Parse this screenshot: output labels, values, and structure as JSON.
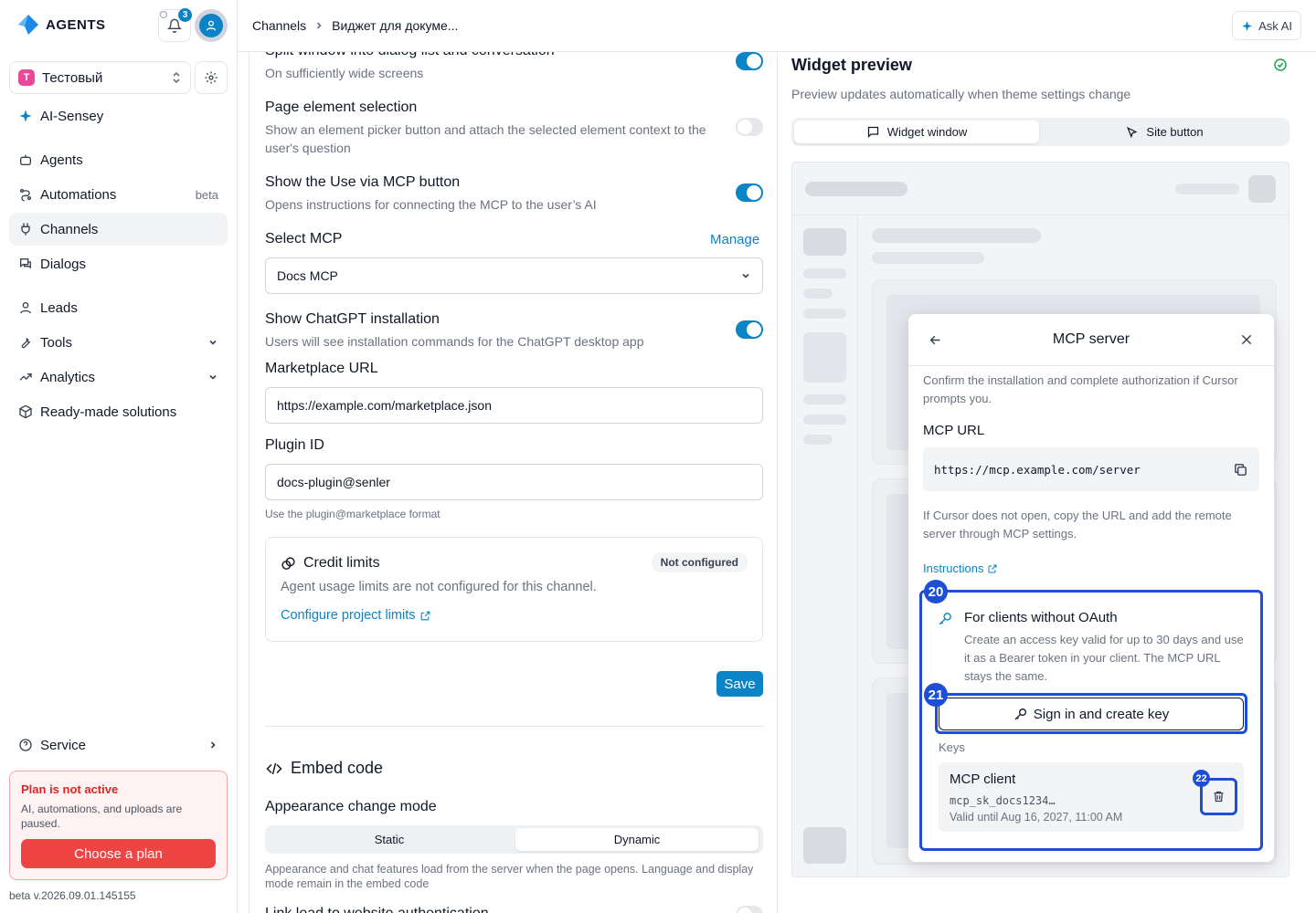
{
  "app": {
    "logo_text": "AGENTS",
    "notification_count": "3"
  },
  "project": {
    "initial": "T",
    "name": "Тестовый"
  },
  "nav": {
    "ai_sensey": "AI-Sensey",
    "agents": "Agents",
    "automations": "Automations",
    "automations_badge": "beta",
    "channels": "Channels",
    "dialogs": "Dialogs",
    "leads": "Leads",
    "tools": "Tools",
    "analytics": "Analytics",
    "ready_made": "Ready-made solutions",
    "service": "Service"
  },
  "plan": {
    "title": "Plan is not active",
    "text": "AI, automations, and uploads are paused.",
    "button": "Choose a plan"
  },
  "version": "beta v.2026.09.01.145155",
  "breadcrumb": {
    "root": "Channels",
    "current": "Виджет для докуме..."
  },
  "ask_ai": "Ask AI",
  "settings": {
    "split_title": "Split window into dialog list and conversation",
    "split_sub": "On sufficiently wide screens",
    "split_on": true,
    "page_sel_title": "Page element selection",
    "page_sel_sub": "Show an element picker button and attach the selected element context to the user's question",
    "page_sel_on": false,
    "mcp_btn_title": "Show the Use via MCP button",
    "mcp_btn_sub": "Opens instructions for connecting the MCP to the user’s AI",
    "mcp_btn_on": true,
    "select_mcp_label": "Select MCP",
    "manage_link": "Manage",
    "select_mcp_value": "Docs MCP",
    "chatgpt_title": "Show ChatGPT installation",
    "chatgpt_sub": "Users will see installation commands for the ChatGPT desktop app",
    "chatgpt_on": true,
    "marketplace_label": "Marketplace URL",
    "marketplace_value": "https://example.com/marketplace.json",
    "plugin_label": "Plugin ID",
    "plugin_value": "docs-plugin@senler",
    "plugin_hint": "Use the plugin@marketplace format",
    "credit_title": "Credit limits",
    "credit_badge": "Not configured",
    "credit_text": "Agent usage limits are not configured for this channel.",
    "credit_link": "Configure project limits",
    "save": "Save",
    "embed_title": "Embed code",
    "appearance_label": "Appearance change mode",
    "appearance_options": [
      "Static",
      "Dynamic"
    ],
    "appearance_selected": "Dynamic",
    "appearance_hint": "Appearance and chat features load from the server when the page opens. Language and display mode remain in the embed code",
    "link_lead_title": "Link lead to website authentication"
  },
  "preview": {
    "title": "Widget preview",
    "subtitle": "Preview updates automatically when theme settings change",
    "tabs": [
      "Widget window",
      "Site button"
    ],
    "selected_tab": "Widget window"
  },
  "dialog": {
    "title": "MCP server",
    "confirm_text": "Confirm the installation and complete authorization if Cursor prompts you.",
    "url_label": "MCP URL",
    "url_value": "https://mcp.example.com/server",
    "fallback_text": "If Cursor does not open, copy the URL and add the remote server through MCP settings.",
    "instructions_link": "Instructions",
    "oauth_title": "For clients without OAuth",
    "oauth_text": "Create an access key valid for up to 30 days and use it as a Bearer token in your client. The MCP URL stays the same.",
    "sign_btn": "Sign in and create key",
    "keys_label": "Keys",
    "key_name": "MCP client",
    "key_value": "mcp_sk_docs1234…",
    "key_valid": "Valid until Aug 16, 2027, 11:00 AM",
    "markers": [
      "20",
      "21",
      "22"
    ]
  },
  "colors": {
    "accent": "#0a84c6",
    "danger": "#ef4444",
    "highlight": "#1d4ed8"
  }
}
